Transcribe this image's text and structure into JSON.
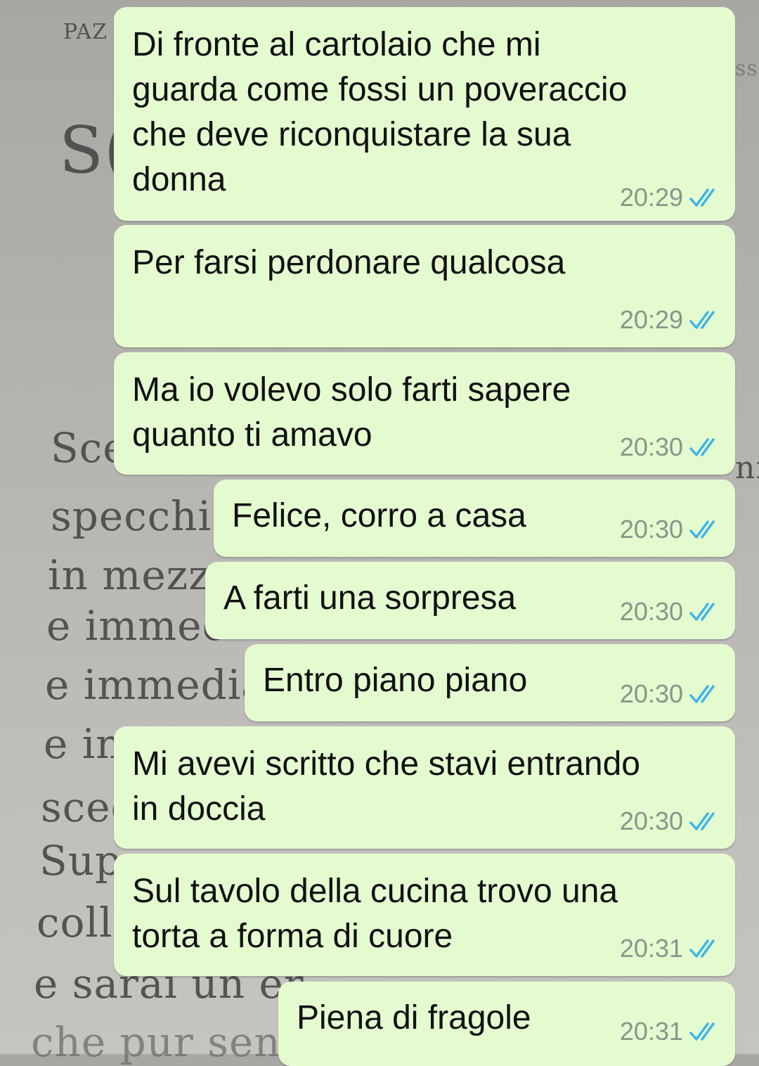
{
  "background_page": {
    "fragments": [
      "PAZ",
      "S(",
      "ss",
      "Sce",
      "ni",
      "specchio",
      "in mezz",
      "e immec",
      "e immedia",
      "e in",
      "sceg",
      "Sup",
      "coll",
      "e sarai un er",
      "che pur senz"
    ]
  },
  "colors": {
    "bubble": "#e4fbd0",
    "text": "#111111",
    "time": "#8a958a",
    "read_ticks": "#3fb4e8"
  },
  "messages": [
    {
      "text": "Di fronte al cartolaio che mi\nguarda come fossi un poveraccio\nche deve riconquistare la sua\ndonna",
      "time": "20:29",
      "status_icon": "double-check-read"
    },
    {
      "text": "Per farsi perdonare qualcosa",
      "time": "20:29",
      "status_icon": "double-check-read"
    },
    {
      "text": "Ma io volevo solo farti sapere\nquanto ti amavo",
      "time": "20:30",
      "status_icon": "double-check-read"
    },
    {
      "text": "Felice, corro a casa",
      "time": "20:30",
      "status_icon": "double-check-read"
    },
    {
      "text": "A farti una sorpresa",
      "time": "20:30",
      "status_icon": "double-check-read"
    },
    {
      "text": "Entro piano piano",
      "time": "20:30",
      "status_icon": "double-check-read"
    },
    {
      "text": "Mi avevi scritto che stavi entrando\nin doccia",
      "time": "20:30",
      "status_icon": "double-check-read"
    },
    {
      "text": "Sul tavolo della cucina trovo una\ntorta a forma di cuore",
      "time": "20:31",
      "status_icon": "double-check-read"
    },
    {
      "text": "Piena di fragole",
      "time": "20:31",
      "status_icon": "double-check-read"
    }
  ]
}
